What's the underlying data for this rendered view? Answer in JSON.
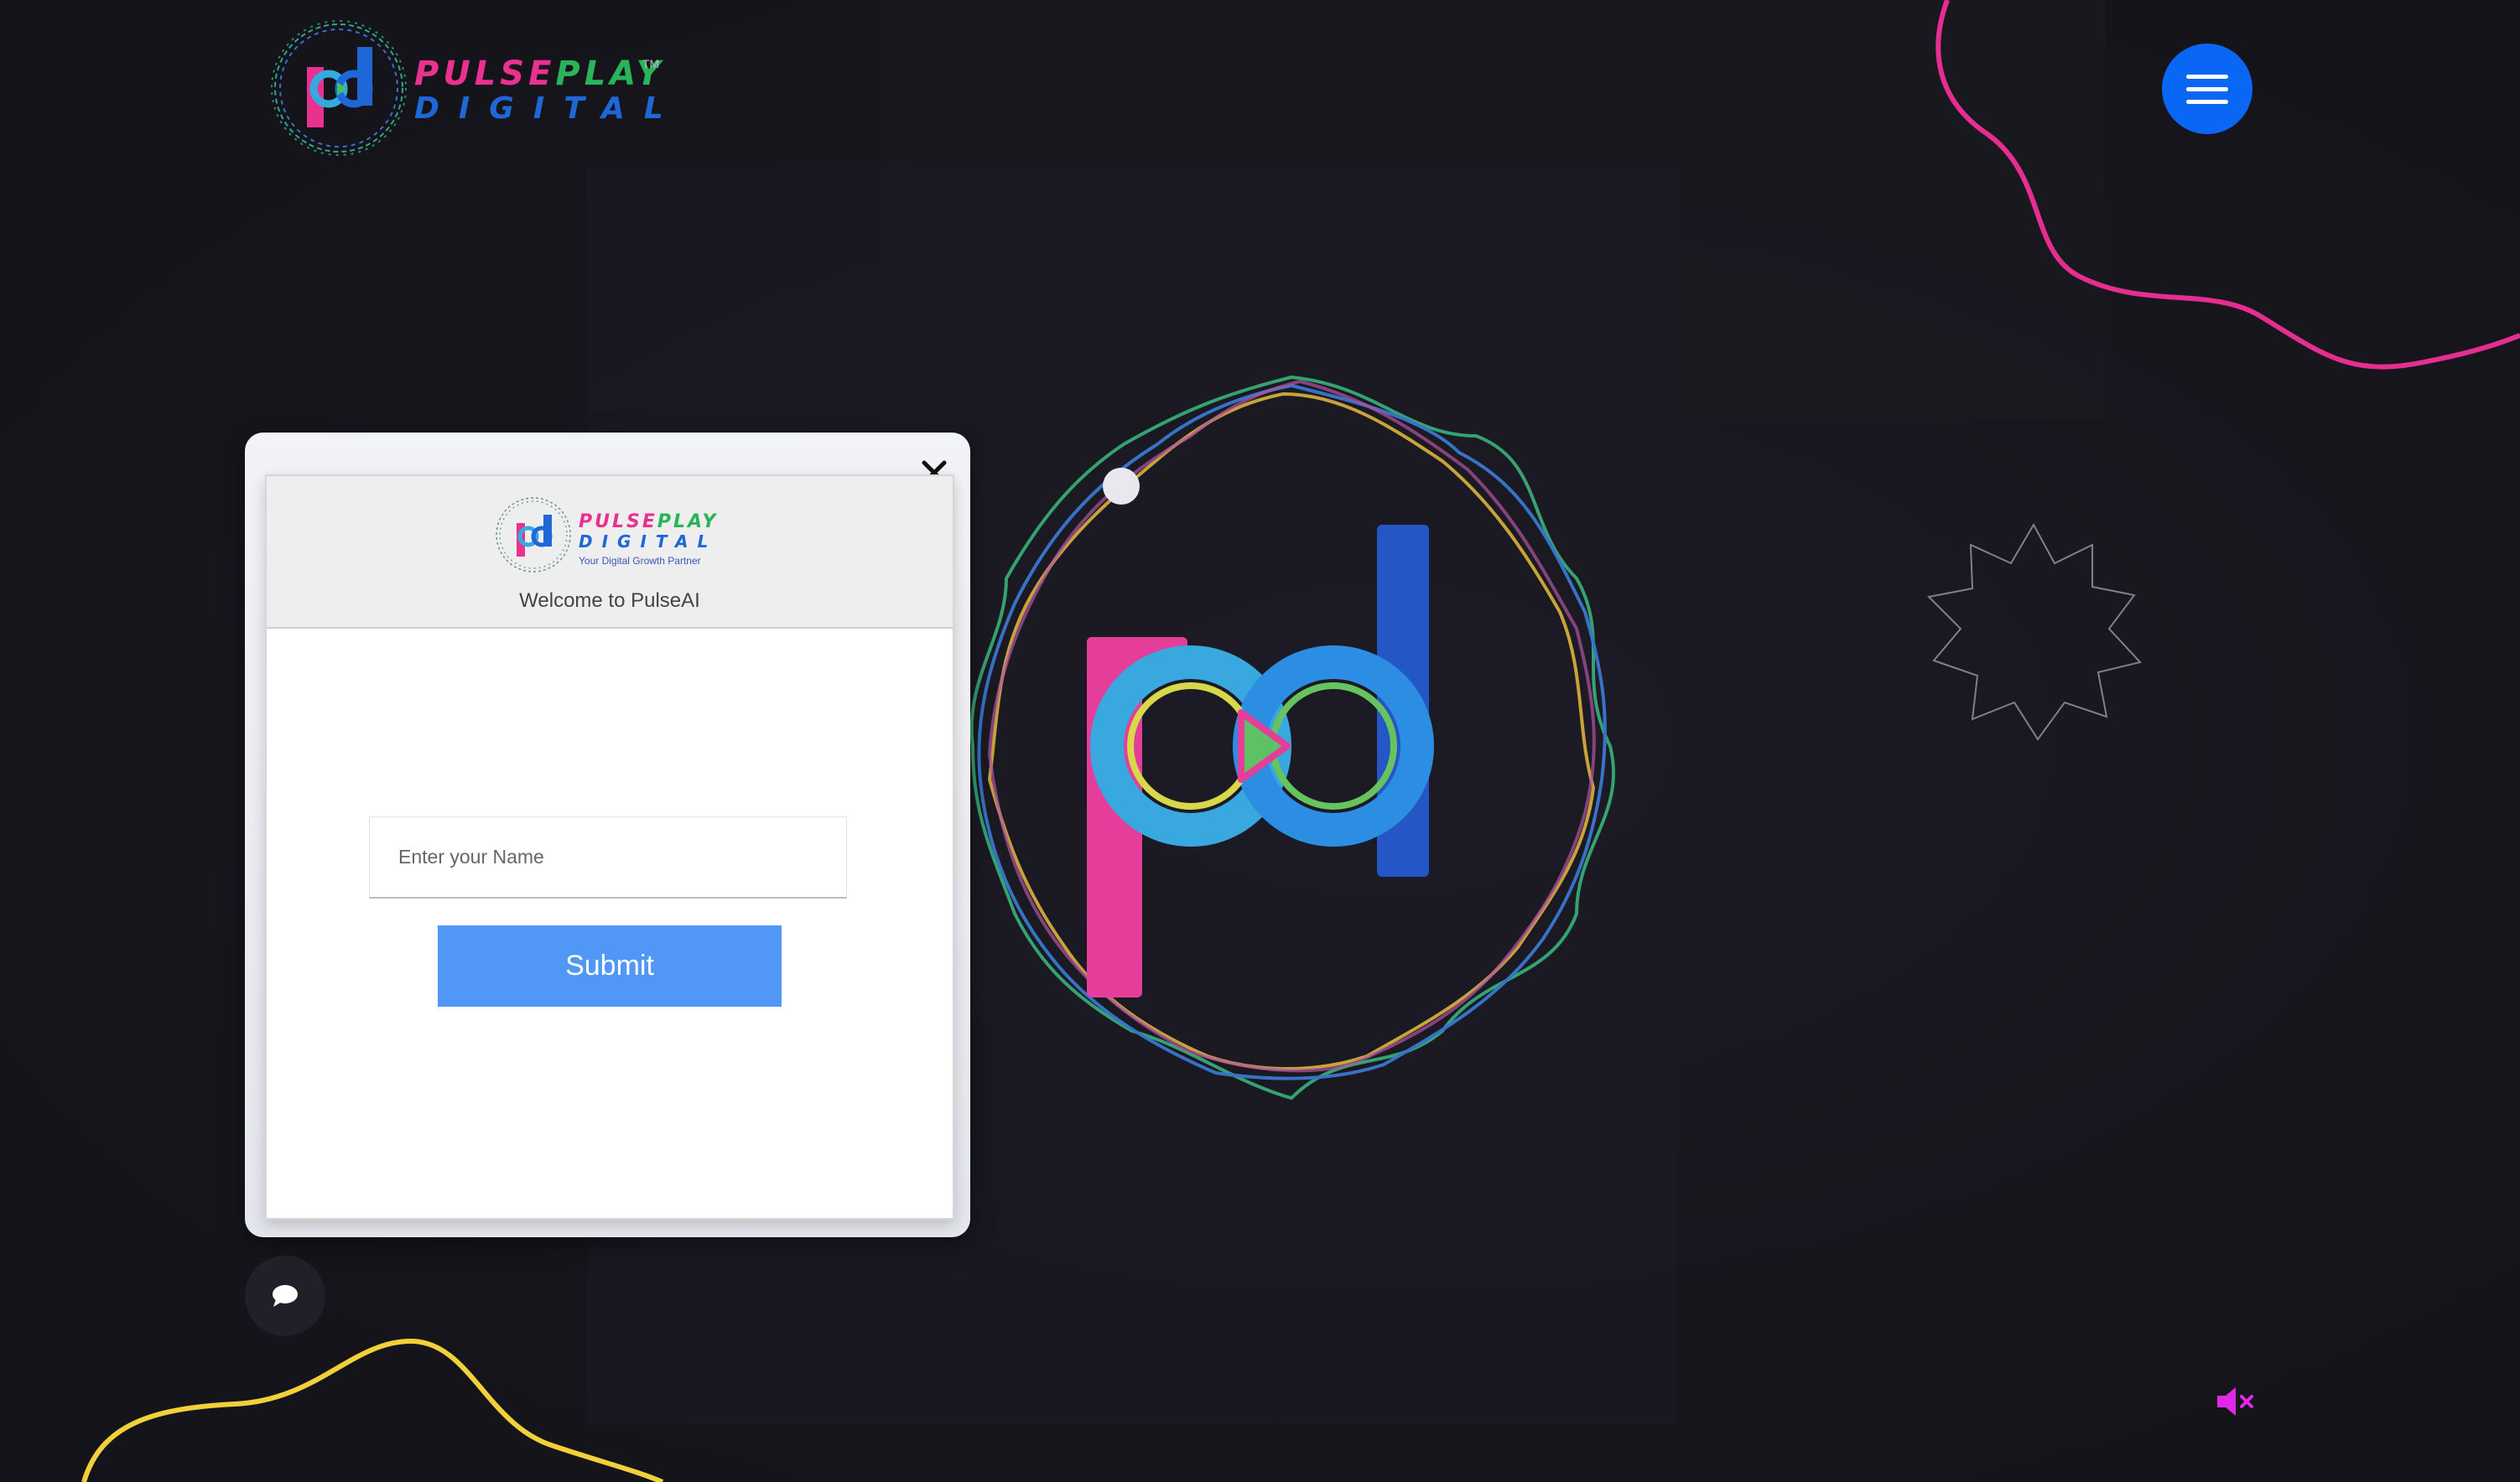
{
  "brand": {
    "name_part1": "PULSE",
    "name_part2": "PLAY",
    "name_line2": "DIGITAL",
    "trademark": "TM",
    "logo_monogram": "pd"
  },
  "header": {
    "menu_icon": "hamburger-menu-icon"
  },
  "chat_modal": {
    "brand_part1": "PULSE",
    "brand_part2": "PLAY",
    "brand_line2": "DIGITAL",
    "tagline": "Your Digital Growth Partner",
    "welcome": "Welcome to PulseAI",
    "name_placeholder": "Enter your Name",
    "name_value": "",
    "submit_label": "Submit",
    "close_icon": "close-icon"
  },
  "chat_launcher": {
    "icon": "chat-bubble-icon"
  },
  "sound": {
    "icon": "speaker-muted-icon",
    "muted": true
  },
  "colors": {
    "background": "#17161d",
    "menu_button": "#0a66f5",
    "submit_button": "#5197f6",
    "brand_pink": "#e9318f",
    "brand_green": "#29b35a",
    "brand_blue": "#1f66d6",
    "mute_icon": "#e028e8"
  }
}
